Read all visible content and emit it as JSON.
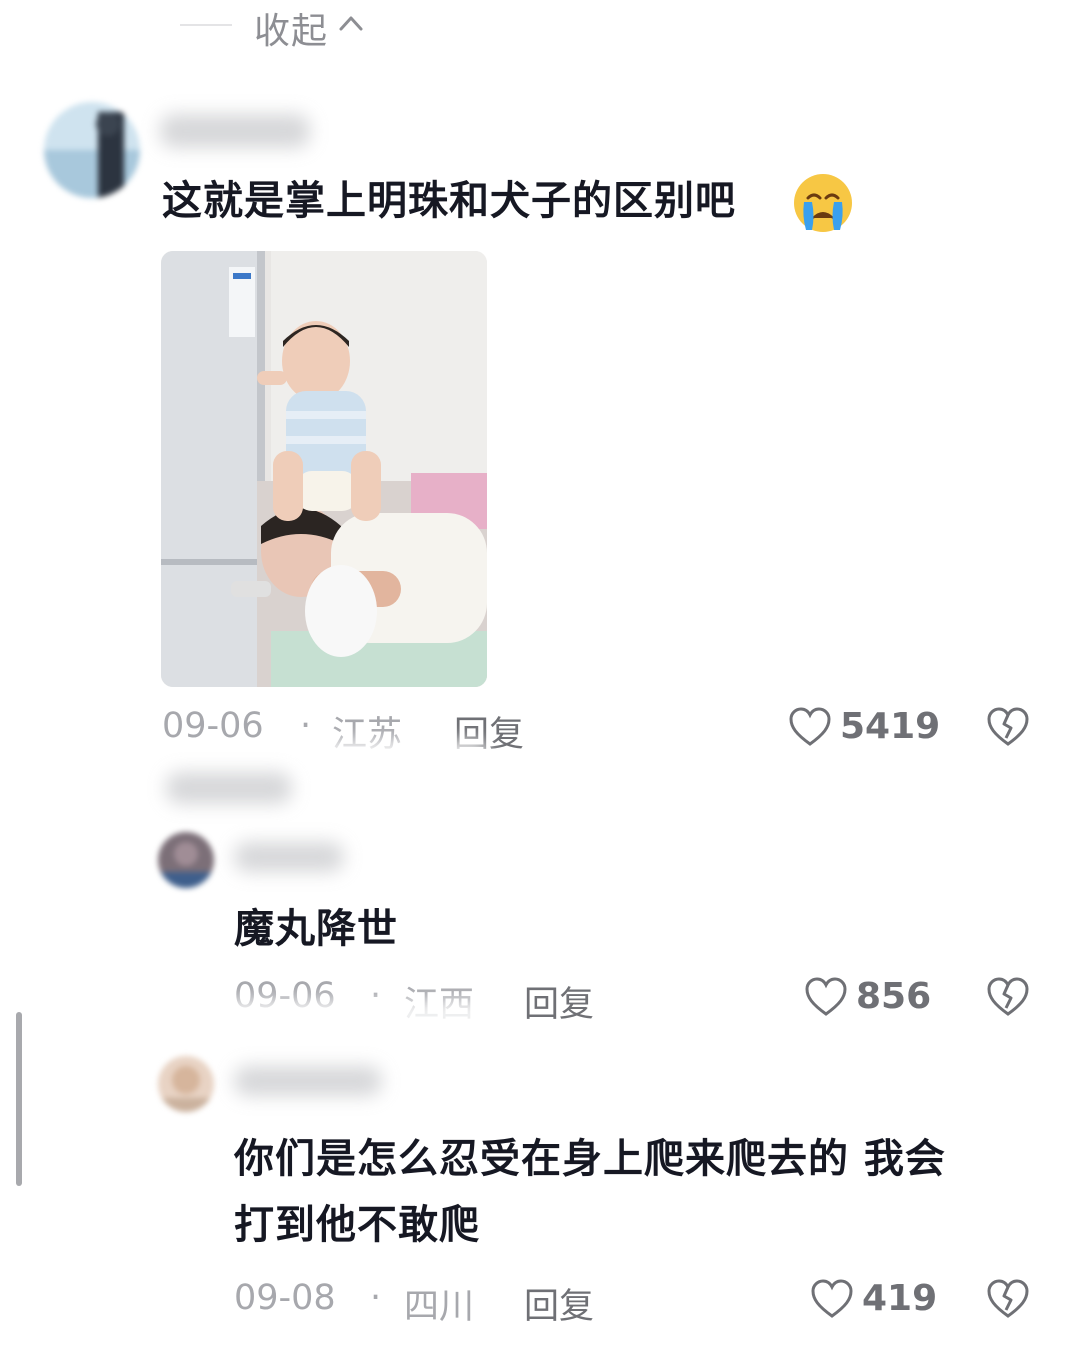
{
  "collapse": {
    "label": "收起"
  },
  "comments": [
    {
      "text": "这就是掌上明珠和犬子的区别吧",
      "emoji": "crying-face",
      "has_image": true,
      "date": "09-06",
      "location": "江苏",
      "reply_label": "回复",
      "likes": "5419"
    },
    {
      "text": "魔丸降世",
      "date": "09-06",
      "location": "江西",
      "reply_label": "回复",
      "likes": "856"
    },
    {
      "text_line1": "你们是怎么忍受在身上爬来爬去的 我会",
      "text_line2": "打到他不敢爬",
      "date": "09-08",
      "location": "四川",
      "reply_label": "回复",
      "likes": "419"
    }
  ],
  "separator": "·",
  "icons": {
    "like": "heart-outline-icon",
    "dislike": "broken-heart-icon",
    "collapse": "chevron-up-icon"
  },
  "colors": {
    "text": "#161823",
    "muted": "#a7a8ad",
    "emoji": "#f7c744",
    "tears": "#3aa0ee"
  }
}
